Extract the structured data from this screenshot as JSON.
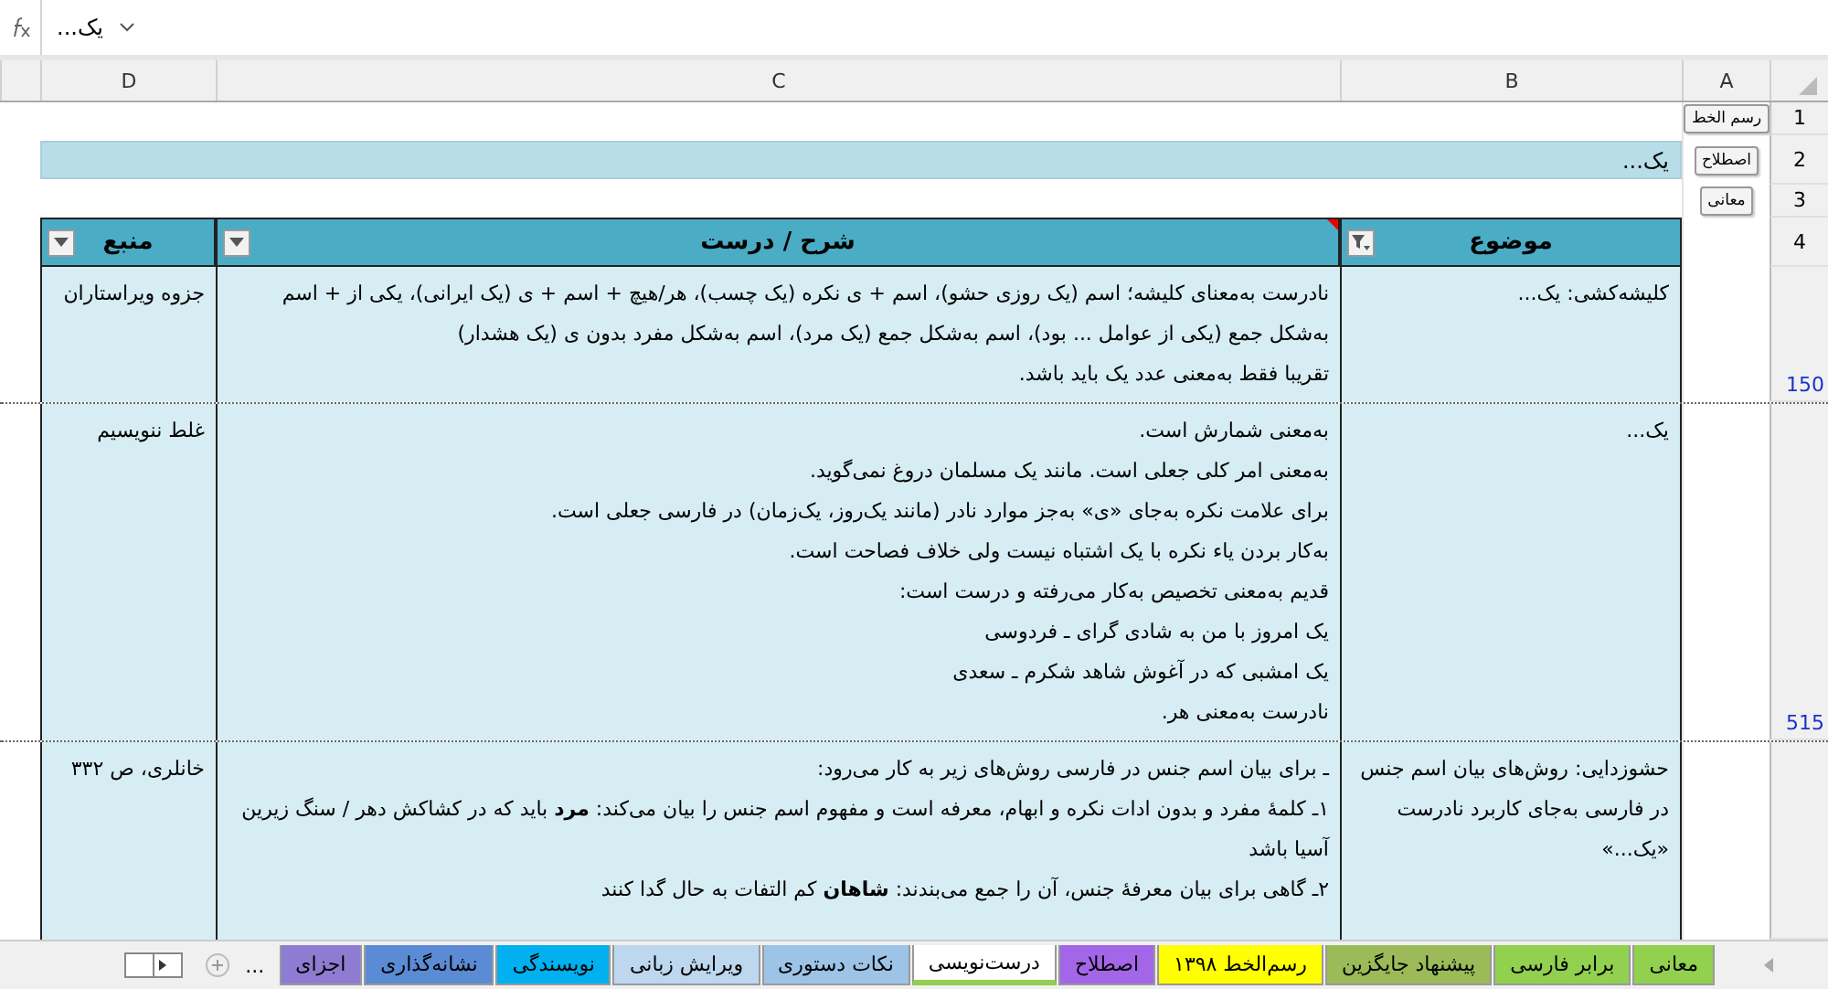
{
  "formula_bar": {
    "value": "یک..."
  },
  "column_headers": [
    "A",
    "B",
    "C",
    "D"
  ],
  "side_buttons": [
    "رسم الخط",
    "اصطلاح",
    "معانی"
  ],
  "title_band": "یک...",
  "table": {
    "columns": [
      {
        "label": "موضوع",
        "filtered": true,
        "has_comment": false
      },
      {
        "label": "شرح / درست",
        "filtered": false,
        "has_comment": true
      },
      {
        "label": "منبع",
        "filtered": false,
        "has_comment": false
      }
    ],
    "rows": [
      {
        "row_number": "150",
        "topic": "کلیشه‌کشی: یک...",
        "lines": [
          "نادرست به‌معنای کلیشه؛ اسم (یک روزی حشو)، اسم + ی نکره (یک چسب)،  هر/هیچ + اسم + ی (یک ایرانی)، یکی از + اسم به‌شکل جمع (یکی از عوامل ... بود)، اسم به‌شکل جمع (یک مرد)، اسم به‌شکل مفرد بدون ی (یک هشدار)",
          "تقریبا فقط به‌معنی عدد یک باید باشد."
        ],
        "source": "جزوه ویراستاران"
      },
      {
        "row_number": "515",
        "topic": "یک...",
        "lines": [
          "به‌معنی شمارش است.",
          "به‌معنی امر کلی جعلی است. مانند یک مسلمان دروغ نمی‌گوید.",
          "برای علامت نکره به‌جای «ی» به‌جز موارد نادر (مانند یک‌روز، یک‌زمان) در فارسی جعلی است.",
          "به‌کار بردن یاء نکره با یک اشتباه نیست ولی خلاف فصاحت است.",
          "قدیم به‌معنی تخصیص به‌کار می‌رفته و درست است:",
          "یک امروز با من به شادی گرای ـ فردوسی",
          "یک امشبی که در آغوش شاهد شکرم ـ سعدی",
          "نادرست به‌معنی هر."
        ],
        "source": "غلط ننویسیم"
      },
      {
        "topic": "حشوزدایی: روش‌های بیان اسم جنس در فارسی به‌جای کاربرد نادرست «یک...»",
        "lines": [
          "ـ برای بیان اسم جنس در فارسی روش‌های زیر به کار می‌رود:",
          "۱ـ کلمهٔ مفرد و بدون ادات نکره و ابهام، معرفه است و مفهوم اسم جنس را بیان می‌کند: **مرد** باید که در کشاکش دهر / سنگ زیرین آسیا باشد",
          "۲ـ گاهی برای بیان معرفهٔ جنس، آن را جمع می‌بندند: **شاهان** کم التفات به حال گدا کنند"
        ],
        "source": "خانلری، ص ۳۳۲"
      }
    ]
  },
  "row_labels": [
    "1",
    "2",
    "3",
    "4"
  ],
  "sheet_tabs": [
    {
      "label": "معانی",
      "color": "#92d050",
      "selected": false
    },
    {
      "label": "برابر فارسی",
      "color": "#92d050",
      "selected": false
    },
    {
      "label": "پیشنهاد جایگزین",
      "color": "#9bbb59",
      "selected": false
    },
    {
      "label": "رسم‌الخط ۱۳۹۸",
      "color": "#ffff00",
      "selected": false
    },
    {
      "label": "اصطلاح",
      "color": "#a366e8",
      "selected": false
    },
    {
      "label": "درست‌نویسی",
      "color": "#92d050",
      "selected": true
    },
    {
      "label": "نکات دستوری",
      "color": "#9dc3e6",
      "selected": false
    },
    {
      "label": "ویرایش زبانی",
      "color": "#bdd7ee",
      "selected": false
    },
    {
      "label": "نویسندگی",
      "color": "#00b0f0",
      "selected": false
    },
    {
      "label": "نشانه‌گذاری",
      "color": "#5b8bd5",
      "selected": false
    },
    {
      "label": "اجزای",
      "color": "#8e7cd3",
      "selected": false
    }
  ],
  "more_tabs": "..."
}
